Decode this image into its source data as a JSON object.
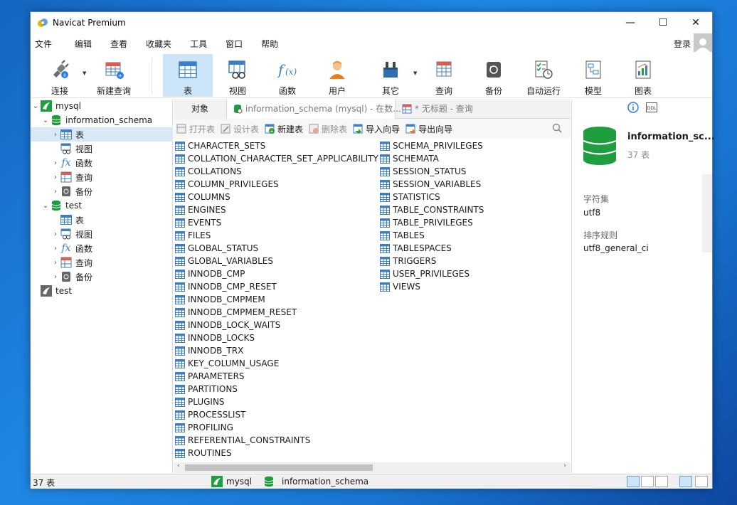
{
  "window": {
    "title": "Navicat Premium",
    "minimize": "—",
    "maximize": "☐",
    "close": "✕"
  },
  "menu": {
    "items": [
      "文件",
      "编辑",
      "查看",
      "收藏夹",
      "工具",
      "窗口",
      "帮助"
    ],
    "login": "登录"
  },
  "toolbar": {
    "buttons": [
      {
        "label": "连接",
        "icon": "plug-icon"
      },
      {
        "label": "新建查询",
        "icon": "new-query-icon"
      },
      {
        "label": "表",
        "icon": "table-icon",
        "active": true
      },
      {
        "label": "视图",
        "icon": "view-icon"
      },
      {
        "label": "函数",
        "icon": "function-icon"
      },
      {
        "label": "用户",
        "icon": "user-icon"
      },
      {
        "label": "其它",
        "icon": "tools-icon"
      },
      {
        "label": "查询",
        "icon": "query-icon"
      },
      {
        "label": "备份",
        "icon": "backup-icon"
      },
      {
        "label": "自动运行",
        "icon": "schedule-icon"
      },
      {
        "label": "模型",
        "icon": "model-icon"
      },
      {
        "label": "图表",
        "icon": "chart-icon"
      }
    ]
  },
  "tree": {
    "conn1": "mysql",
    "db1": "information_schema",
    "db1_children": [
      "表",
      "视图",
      "函数",
      "查询",
      "备份"
    ],
    "db2": "test",
    "db2_children": [
      "表",
      "视图",
      "函数",
      "查询",
      "备份"
    ],
    "conn2": "test"
  },
  "tabs": {
    "objects": "对象",
    "schema_tab": "information_schema (mysql) - 在数...",
    "query_tab": "* 无标题 - 查询"
  },
  "object_toolbar": {
    "open": "打开表",
    "design": "设计表",
    "new": "新建表",
    "delete": "删除表",
    "import": "导入向导",
    "export": "导出向导"
  },
  "tables_col1": [
    "CHARACTER_SETS",
    "COLLATION_CHARACTER_SET_APPLICABILITY",
    "COLLATIONS",
    "COLUMN_PRIVILEGES",
    "COLUMNS",
    "ENGINES",
    "EVENTS",
    "FILES",
    "GLOBAL_STATUS",
    "GLOBAL_VARIABLES",
    "INNODB_CMP",
    "INNODB_CMP_RESET",
    "INNODB_CMPMEM",
    "INNODB_CMPMEM_RESET",
    "INNODB_LOCK_WAITS",
    "INNODB_LOCKS",
    "INNODB_TRX",
    "KEY_COLUMN_USAGE",
    "PARAMETERS",
    "PARTITIONS",
    "PLUGINS",
    "PROCESSLIST",
    "PROFILING",
    "REFERENTIAL_CONSTRAINTS",
    "ROUTINES"
  ],
  "tables_col2": [
    "SCHEMA_PRIVILEGES",
    "SCHEMATA",
    "SESSION_STATUS",
    "SESSION_VARIABLES",
    "STATISTICS",
    "TABLE_CONSTRAINTS",
    "TABLE_PRIVILEGES",
    "TABLES",
    "TABLESPACES",
    "TRIGGERS",
    "USER_PRIVILEGES",
    "VIEWS"
  ],
  "info": {
    "title": "information_sc...",
    "count": "37 表",
    "charset_label": "字符集",
    "charset_value": "utf8",
    "collation_label": "排序规则",
    "collation_value": "utf8_general_ci"
  },
  "status": {
    "count": "37 表",
    "connection": "mysql",
    "database": "information_schema"
  },
  "colors": {
    "accent": "#cce4f7",
    "db_green": "#1e9e3e",
    "table_blue": "#3c7fc8"
  }
}
